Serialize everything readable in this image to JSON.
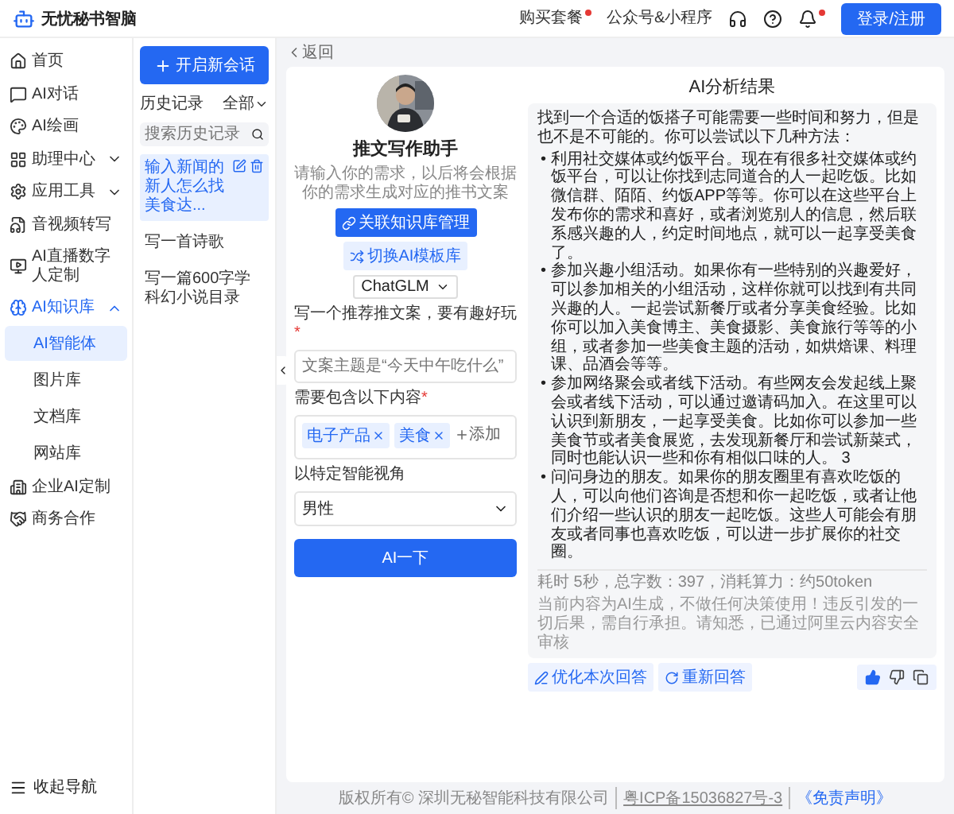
{
  "brand": {
    "name": "无忧秘书智脑"
  },
  "topbar": {
    "links": [
      {
        "label": "购买套餐",
        "dot": true
      },
      {
        "label": "公众号&小程序",
        "dot": false
      }
    ],
    "icons": [
      {
        "kind": "support",
        "dot": false
      },
      {
        "kind": "help",
        "dot": false
      },
      {
        "kind": "bell",
        "dot": true
      }
    ],
    "login": "登录/注册"
  },
  "sidebar": {
    "items": [
      {
        "label": "首页",
        "selected": false
      },
      {
        "label": "AI对话",
        "selected": false
      },
      {
        "label": "AI绘画",
        "selected": false
      },
      {
        "label": "助理中心",
        "selected": false,
        "expanded": false
      },
      {
        "label": "应用工具",
        "selected": false,
        "expanded": false
      },
      {
        "label": "音视频转写",
        "selected": false
      },
      {
        "label": "AI直播数字人定制",
        "selected": false
      },
      {
        "label": "AI知识库",
        "selected": true,
        "expanded": true,
        "children": [
          {
            "label": "AI智能体",
            "selected": true
          },
          {
            "label": "图片库",
            "selected": false
          },
          {
            "label": "文档库",
            "selected": false
          },
          {
            "label": "网站库",
            "selected": false
          }
        ]
      },
      {
        "label": "企业AI定制",
        "selected": false
      },
      {
        "label": "商务合作",
        "selected": false
      }
    ],
    "collapse": "收起导航"
  },
  "history": {
    "new_chat": "开启新会话",
    "heading": "历史记录",
    "filter": "全部",
    "search_placeholder": "搜索历史记录",
    "items": [
      {
        "title": "输入新闻的新人怎么找美食达...",
        "selected": true
      },
      {
        "title": "写一首诗歌",
        "selected": false
      },
      {
        "title": "写一篇600字学科幻小说目录",
        "selected": false
      }
    ]
  },
  "main": {
    "back": "返回",
    "assistant": {
      "title": "推文写作助手",
      "subtitle": "请输入你的需求，以后将会根据你的需求生成对应的推书文案",
      "actions": [
        {
          "label": "关联知识库管理",
          "kind": "primary"
        },
        {
          "label": "切换AI模板库",
          "kind": "secondary"
        }
      ],
      "model": "ChatGLM"
    },
    "form": {
      "fields": [
        {
          "kind": "text",
          "label": "写一个推荐推文案，要有趣好玩",
          "required_mark": "*",
          "placeholder": "文案主题是“今天中午吃什么”"
        },
        {
          "kind": "tags",
          "label": "需要包含以下内容",
          "required_mark": "*",
          "tags": [
            "电子产品",
            "美食"
          ],
          "add": "添加"
        },
        {
          "kind": "select",
          "label": "以特定智能视角",
          "value": "男性"
        }
      ],
      "submit": "AI一下"
    },
    "result": {
      "heading": "AI分析结果",
      "intro": "找到一个合适的饭搭子可能需要一些时间和努力，但是也不是不可能的。你可以尝试以下几种方法：",
      "bullet_marker": "•",
      "bullets": [
        "利用社交媒体或约饭平台。现在有很多社交媒体或约饭平台，可以让你找到志同道合的人一起吃饭。比如微信群、陌陌、约饭APP等等。你可以在这些平台上发布你的需求和喜好，或者浏览别人的信息，然后联系感兴趣的人，约定时间地点，就可以一起享受美食了。",
        "参加兴趣小组活动。如果你有一些特别的兴趣爱好，可以参加相关的小组活动，这样你就可以找到有共同兴趣的人。一起尝试新餐厅或者分享美食经验。比如你可以加入美食博主、美食摄影、美食旅行等等的小组，或者参加一些美食主题的活动，如烘焙课、料理课、品酒会等等。",
        "参加网络聚会或者线下活动。有些网友会发起线上聚会或者线下活动，可以通过邀请码加入。在这里可以认识到新朋友，一起享受美食。比如你可以参加一些美食节或者美食展览，去发现新餐厅和尝试新菜式，同时也能认识一些和你有相似口味的人。 3",
        "问问身边的朋友。如果你的朋友圈里有喜欢吃饭的人，可以向他们咨询是否想和你一起吃饭，或者让他们介绍一些认识的朋友一起吃饭。这些人可能会有朋友或者同事也喜欢吃饭，可以进一步扩展你的社交圈。"
      ],
      "meta": "耗时 5秒，总字数：397，消耗算力：约50token",
      "disclaimer": "当前内容为AI生成，不做任何决策使用！违反引发的一切后果，需自行承担。请知悉，已通过阿里云内容安全审核",
      "actions": [
        {
          "label": "优化本次回答",
          "kind": "refine"
        },
        {
          "label": "重新回答",
          "kind": "retry"
        }
      ],
      "feedback": [
        {
          "kind": "like",
          "selected": true
        },
        {
          "kind": "dislike",
          "selected": false
        },
        {
          "kind": "copy"
        }
      ]
    }
  },
  "footer": {
    "copyright": "版权所有© 深圳无秘智能科技有限公司",
    "icp": "粤ICP备15036827号-3",
    "disclaimer": "《免责声明》"
  }
}
